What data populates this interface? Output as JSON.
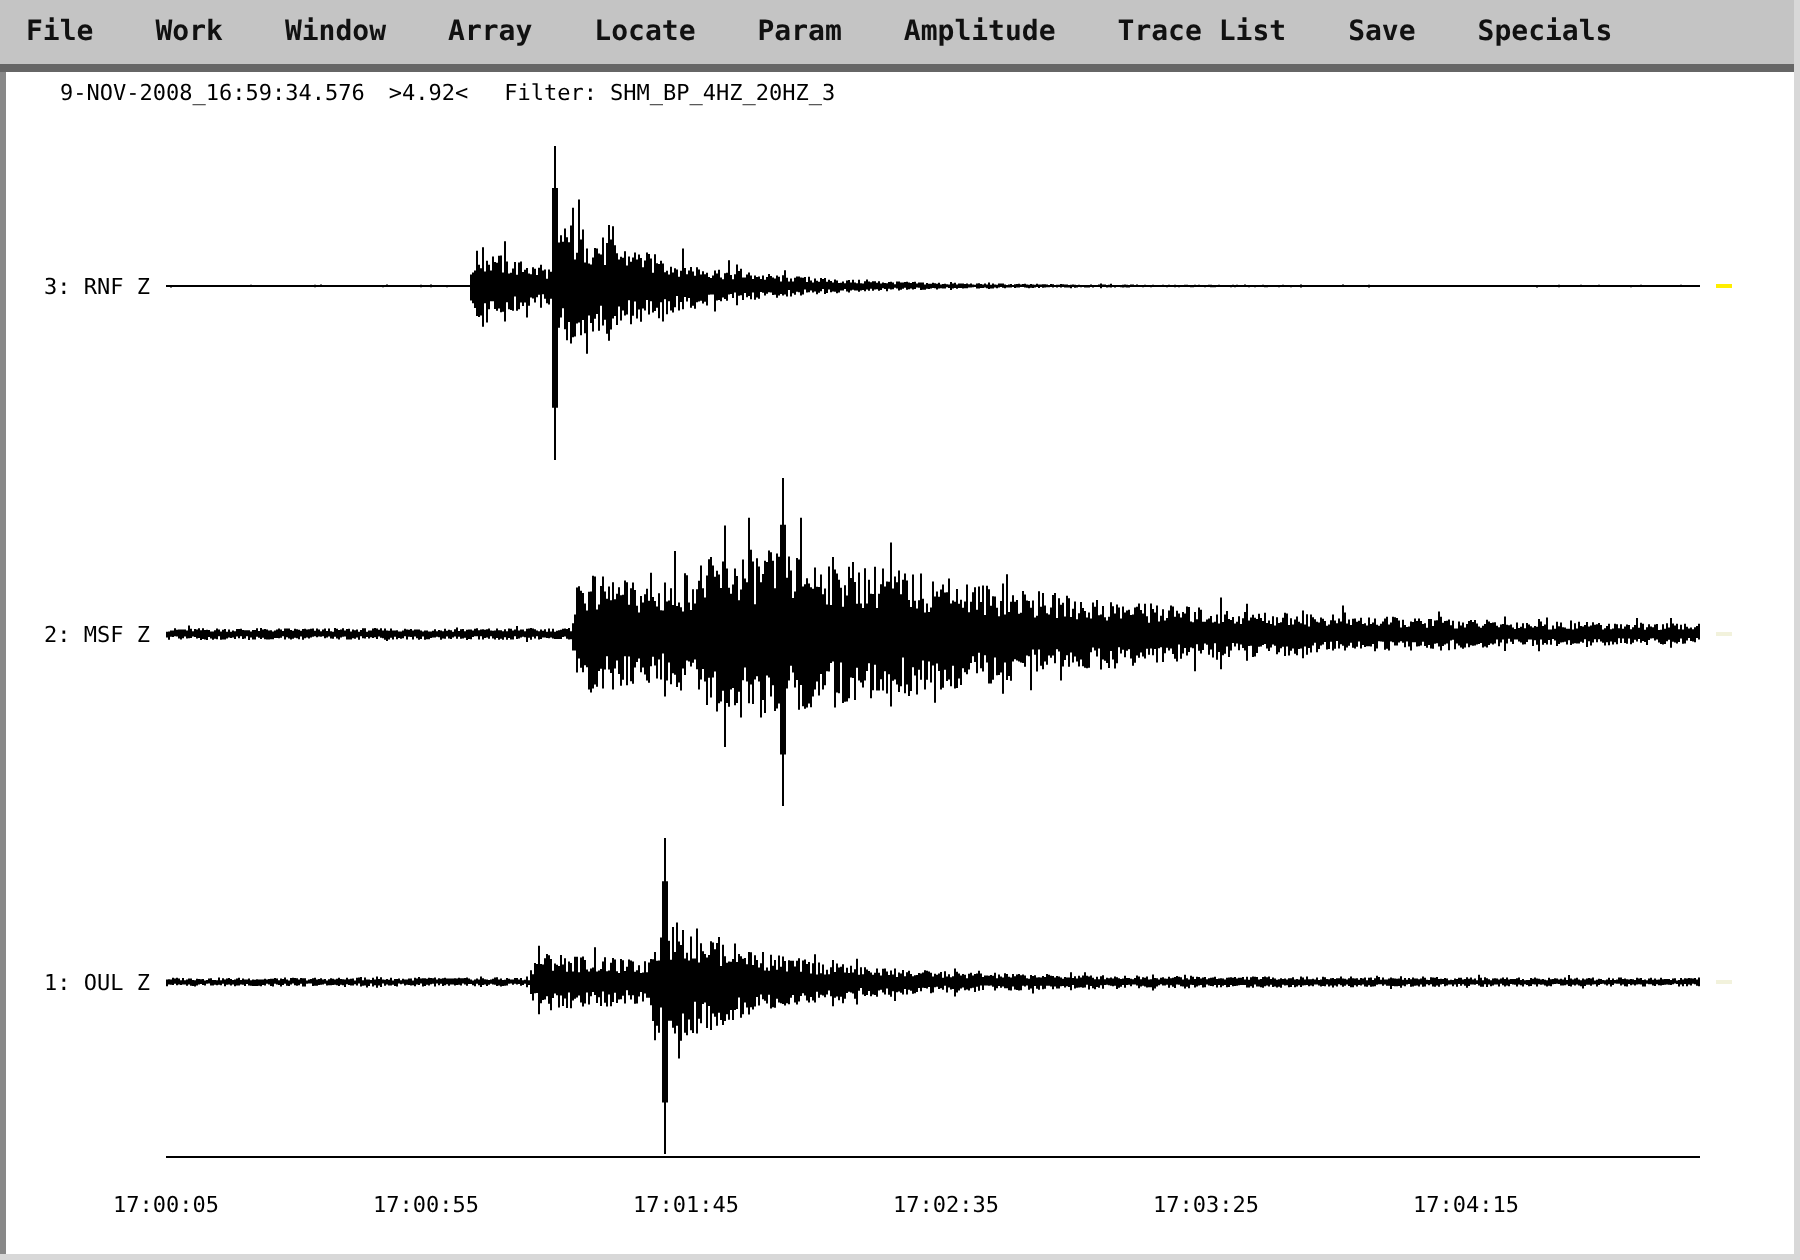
{
  "menu": [
    "File",
    "Work",
    "Window",
    "Array",
    "Locate",
    "Param",
    "Amplitude",
    "Trace List",
    "Save",
    "Specials"
  ],
  "info": {
    "time": "9-NOV-2008_16:59:34.576",
    "scale": ">4.92<",
    "filter": "Filter: SHM_BP_4HZ_20HZ_3"
  },
  "traces": [
    {
      "label": "3: RNF Z",
      "selected": true
    },
    {
      "label": "2: MSF Z",
      "selected": false
    },
    {
      "label": "1: OUL Z",
      "selected": false
    }
  ],
  "time_labels": [
    "17:00:05",
    "17:00:55",
    "17:01:45",
    "17:02:35",
    "17:03:25",
    "17:04:15"
  ]
}
